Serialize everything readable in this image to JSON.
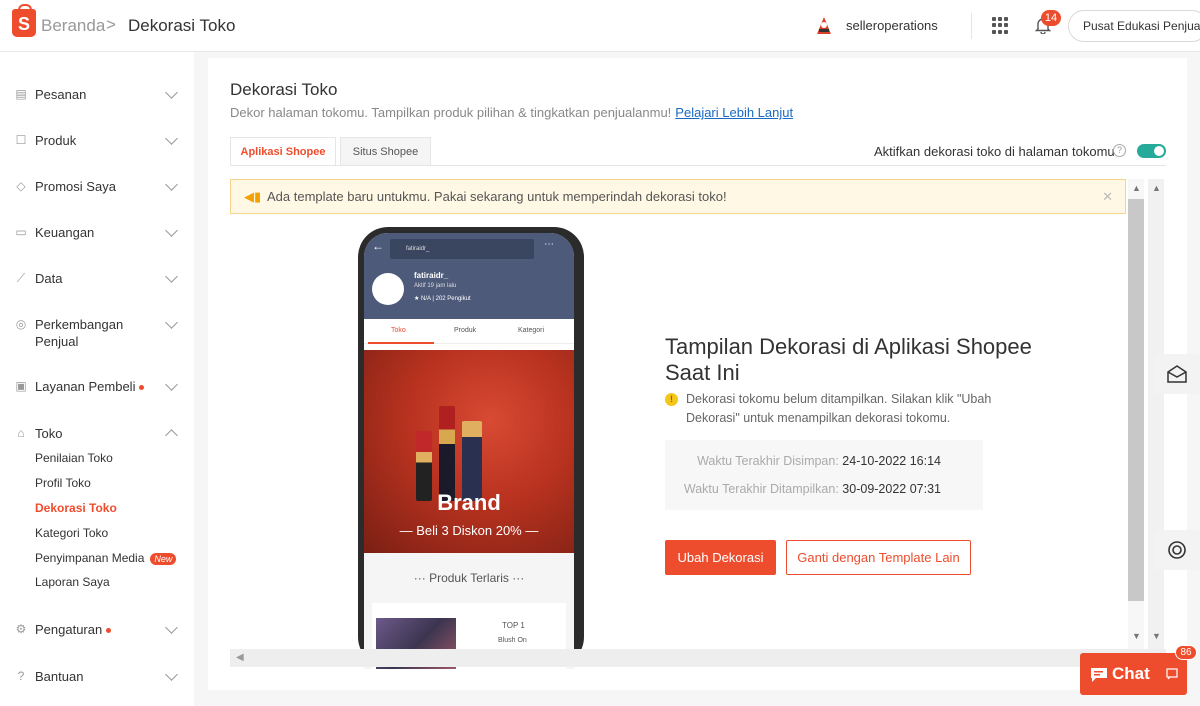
{
  "header": {
    "logo_letter": "S",
    "breadcrumb_home": "Beranda",
    "breadcrumb_separator": ">",
    "breadcrumb_current": "Dekorasi Toko",
    "username": "selleroperations",
    "notification_count": "14",
    "edu_button": "Pusat Edukasi Penjual"
  },
  "sidebar": {
    "items": [
      {
        "label": "Pesanan",
        "icon": "clipboard-icon"
      },
      {
        "label": "Produk",
        "icon": "box-icon"
      },
      {
        "label": "Promosi Saya",
        "icon": "tag-icon"
      },
      {
        "label": "Keuangan",
        "icon": "wallet-icon"
      },
      {
        "label": "Data",
        "icon": "chart-icon"
      },
      {
        "label": "Perkembangan Penjual",
        "icon": "medal-icon"
      },
      {
        "label": "Layanan Pembeli",
        "icon": "headset-icon"
      },
      {
        "label": "Toko",
        "icon": "store-icon"
      },
      {
        "label": "Pengaturan",
        "icon": "gear-icon"
      },
      {
        "label": "Bantuan",
        "icon": "help-icon"
      }
    ],
    "toko_sub": [
      "Penilaian Toko",
      "Profil Toko",
      "Dekorasi Toko",
      "Kategori Toko",
      "Penyimpanan Media",
      "Laporan Saya"
    ],
    "new_badge": "New"
  },
  "main": {
    "title": "Dekorasi Toko",
    "description": "Dekor halaman tokomu. Tampilkan produk pilihan & tingkatkan penjualanmu!",
    "learn_more": "Pelajari Lebih Lanjut",
    "tabs": [
      "Aplikasi Shopee",
      "Situs Shopee"
    ],
    "toggle_label": "Aktifkan dekorasi toko di halaman tokomu",
    "toggle_on": true,
    "notice": "Ada template baru untukmu. Pakai sekarang untuk memperindah dekorasi toko!",
    "phone": {
      "search": "fatiraidr_",
      "shop_name": "fatiraidr_",
      "active": "Aktif 19 jam lalu",
      "stats": "★ N/A | 202 Pengikut",
      "tabs": [
        "Toko",
        "Produk",
        "Kategori"
      ],
      "brand": "Brand",
      "promo": "— Beli 3 Diskon 20% —",
      "section_title": "··· Produk Terlaris ···",
      "product_rank": "TOP 1",
      "product_name": "Blush On"
    },
    "info_title": "Tampilan Dekorasi di Aplikasi Shopee Saat Ini",
    "info_note": "Dekorasi tokomu belum ditampilkan. Silakan klik \"Ubah Dekorasi\" untuk menampilkan dekorasi tokomu.",
    "saved_label": "Waktu Terakhir Disimpan:",
    "saved_value": "24-10-2022 16:14",
    "shown_label": "Waktu Terakhir Ditampilkan:",
    "shown_value": "30-09-2022 07:31",
    "primary_button": "Ubah Dekorasi",
    "secondary_button": "Ganti dengan Template Lain"
  },
  "chat": {
    "label": "Chat",
    "badge": "86"
  },
  "colors": {
    "accent": "#ee4d2d",
    "toggle": "#26aa99",
    "link": "#1a6ac4"
  }
}
